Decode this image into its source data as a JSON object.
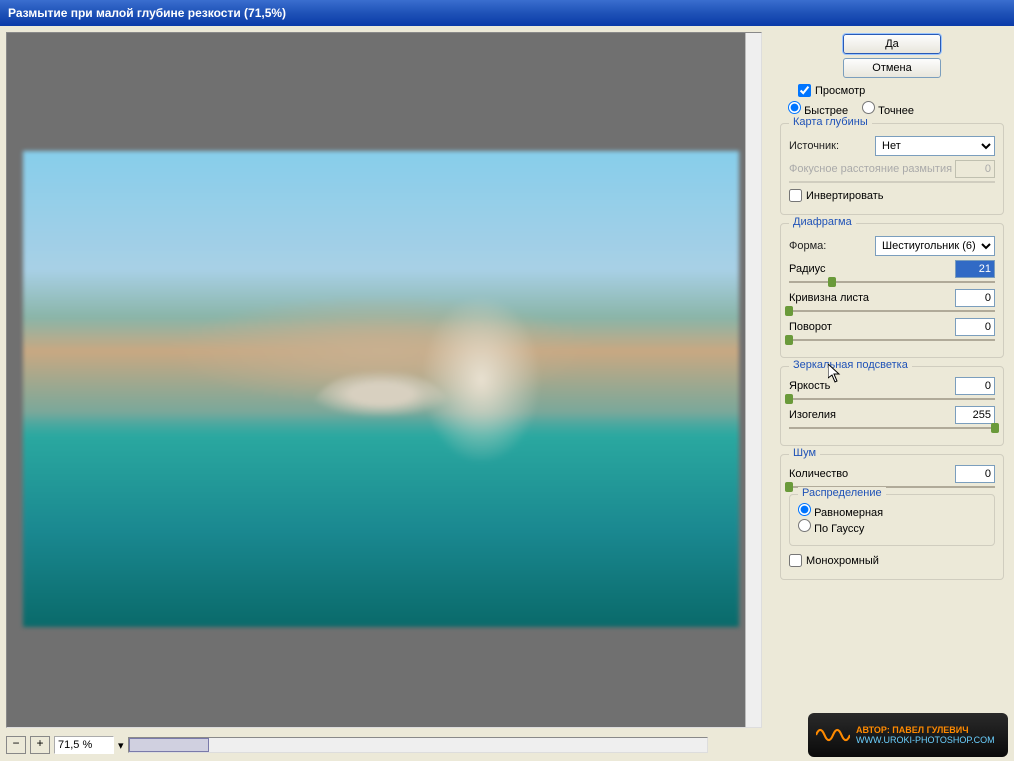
{
  "title": "Размытие при малой глубине резкости (71,5%)",
  "buttons": {
    "ok": "Да",
    "cancel": "Отмена"
  },
  "preview_check": "Просмотр",
  "quality": {
    "fast": "Быстрее",
    "accurate": "Точнее"
  },
  "depthmap": {
    "title": "Карта глубины",
    "source_label": "Источник:",
    "source_value": "Нет",
    "focal_label": "Фокусное расстояние размытия",
    "focal_value": "0",
    "invert": "Инвертировать"
  },
  "iris": {
    "title": "Диафрагма",
    "shape_label": "Форма:",
    "shape_value": "Шестиугольник (6)",
    "radius_label": "Радиус",
    "radius_value": "21",
    "curvature_label": "Кривизна листа",
    "curvature_value": "0",
    "rotation_label": "Поворот",
    "rotation_value": "0"
  },
  "spec": {
    "title": "Зеркальная подсветка",
    "bright_label": "Яркость",
    "bright_value": "0",
    "thresh_label": "Изогелия",
    "thresh_value": "255"
  },
  "noise": {
    "title": "Шум",
    "amount_label": "Количество",
    "amount_value": "0",
    "dist_title": "Распределение",
    "uniform": "Равномерная",
    "gauss": "По Гауссу",
    "mono": "Монохромный"
  },
  "zoom": {
    "value": "71,5 %"
  },
  "logo": {
    "author": "АВТОР: ПАВЕЛ ГУЛЕВИЧ",
    "site": "WWW.UROKI-PHOTOSHOP.COM"
  }
}
